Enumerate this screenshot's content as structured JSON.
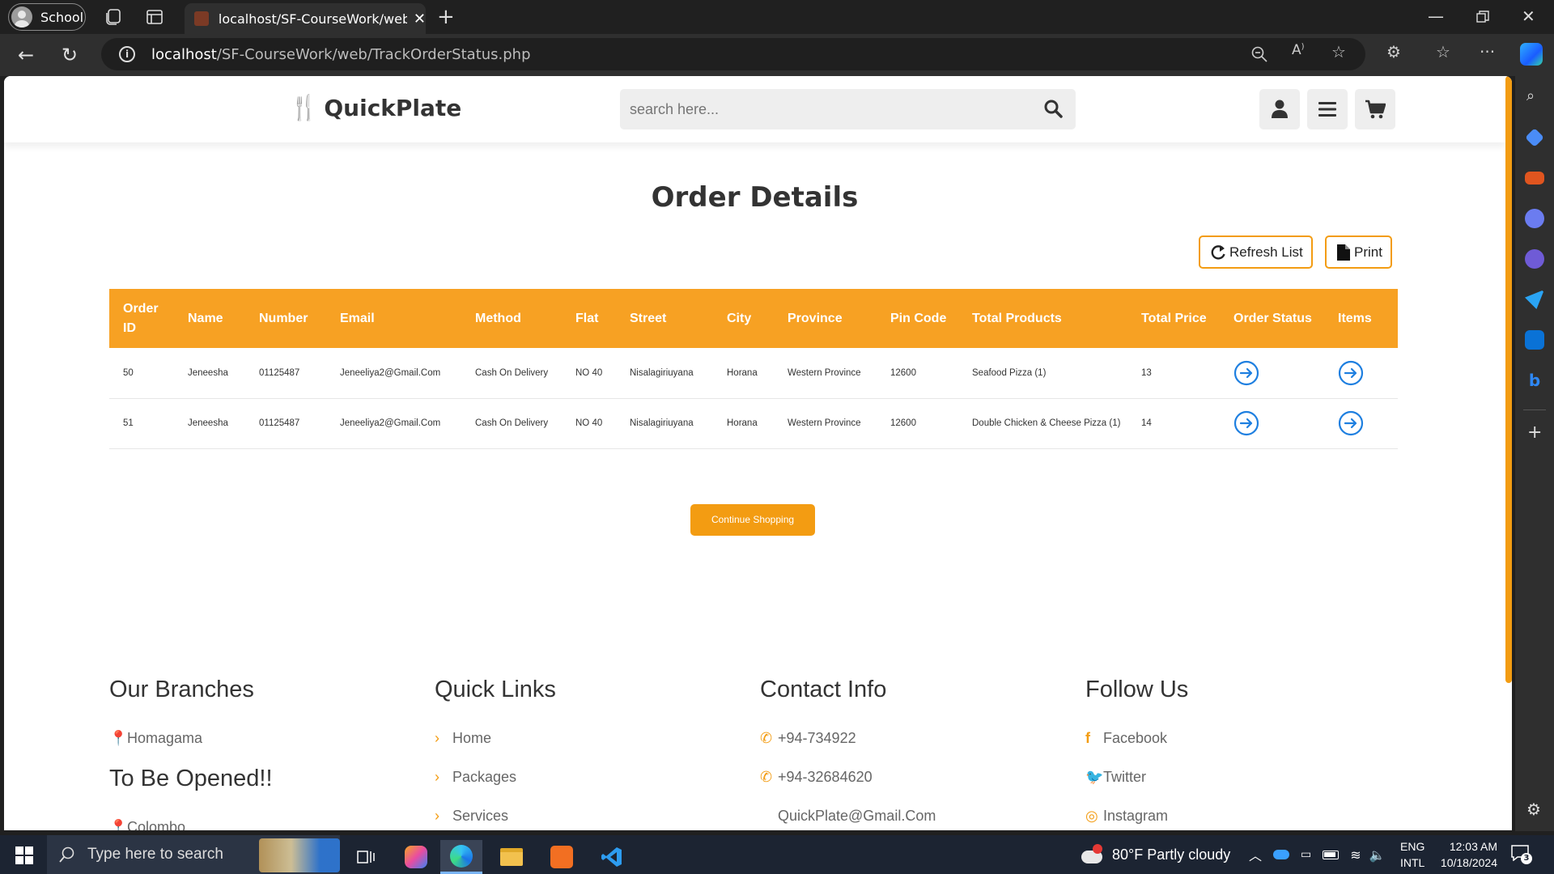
{
  "browser": {
    "profile_label": "School",
    "tab_title": "localhost/SF-CourseWork/web/TrackOrderStatus.php",
    "url_host": "localhost",
    "url_path": "/SF-CourseWork/web/TrackOrderStatus.php"
  },
  "site": {
    "logo_text": "QuickPlate",
    "search_placeholder": "search here...",
    "accent_color": "#f39c12"
  },
  "page": {
    "title": "Order Details",
    "refresh_label": "Refresh List",
    "print_label": "Print",
    "continue_label": "Continue Shopping"
  },
  "table": {
    "headers": {
      "order_id": "Order ID",
      "name": "Name",
      "number": "Number",
      "email": "Email",
      "method": "Method",
      "flat": "Flat",
      "street": "Street",
      "city": "City",
      "province": "Province",
      "pin": "Pin Code",
      "products": "Total Products",
      "price": "Total Price",
      "status": "Order Status",
      "items": "Items"
    },
    "rows": [
      {
        "order_id": "50",
        "name": "Jeneesha",
        "number": "01125487",
        "email": "Jeneeliya2@Gmail.Com",
        "method": "Cash On Delivery",
        "flat": "NO 40",
        "street": "Nisalagiriuyana",
        "city": "Horana",
        "province": "Western Province",
        "pin": "12600",
        "products": "Seafood Pizza (1)",
        "price": "13"
      },
      {
        "order_id": "51",
        "name": "Jeneesha",
        "number": "01125487",
        "email": "Jeneeliya2@Gmail.Com",
        "method": "Cash On Delivery",
        "flat": "NO 40",
        "street": "Nisalagiriuyana",
        "city": "Horana",
        "province": "Western Province",
        "pin": "12600",
        "products": "Double Chicken & Cheese Pizza (1)",
        "price": "14"
      }
    ]
  },
  "footer": {
    "branches_heading": "Our Branches",
    "branch_1": "Homagama",
    "opening_heading": "To Be Opened!!",
    "opening_1": "Colombo",
    "links_heading": "Quick Links",
    "link_home": "Home",
    "link_packages": "Packages",
    "link_services": "Services",
    "contact_heading": "Contact Info",
    "phone_1": "+94-734922",
    "phone_2": "+94-32684620",
    "email": "QuickPlate@Gmail.Com",
    "follow_heading": "Follow Us",
    "facebook": "Facebook",
    "twitter": "Twitter",
    "instagram": "Instagram"
  },
  "taskbar": {
    "search_placeholder": "Type here to search",
    "weather": "80°F  Partly cloudy",
    "lang_1": "ENG",
    "lang_2": "INTL",
    "time": "12:03 AM",
    "date": "10/18/2024",
    "notification_count": "3"
  }
}
